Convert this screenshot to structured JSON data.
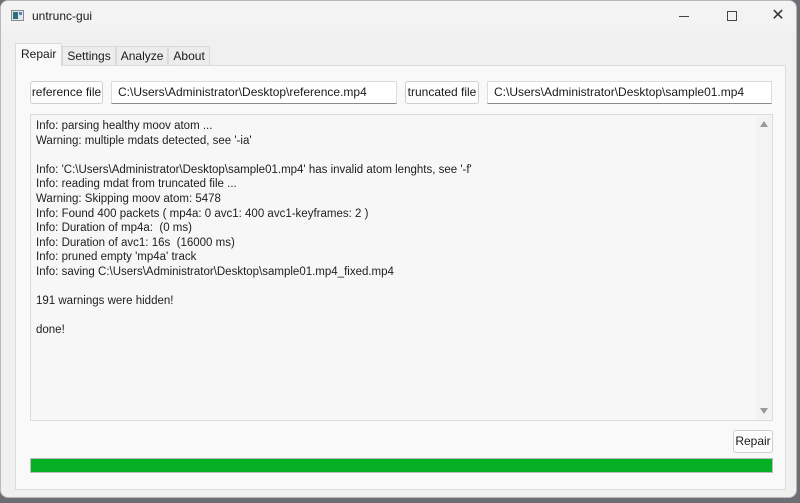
{
  "window": {
    "title": "untrunc-gui",
    "controls": {
      "minimize": "minimize",
      "maximize": "maximize",
      "close": "close"
    }
  },
  "tabs": [
    {
      "label": "Repair",
      "active": true
    },
    {
      "label": "Settings",
      "active": false
    },
    {
      "label": "Analyze",
      "active": false
    },
    {
      "label": "About",
      "active": false
    }
  ],
  "repair": {
    "reference_button": "reference file",
    "reference_path": "C:\\Users\\Administrator\\Desktop\\reference.mp4",
    "truncated_button": "truncated file",
    "truncated_path": "C:\\Users\\Administrator\\Desktop\\sample01.mp4",
    "log_lines": [
      "Info: parsing healthy moov atom ...",
      "Warning: multiple mdats detected, see '-ia'",
      "",
      "Info: 'C:\\Users\\Administrator\\Desktop\\sample01.mp4' has invalid atom lenghts, see '-f'",
      "Info: reading mdat from truncated file ...",
      "Warning: Skipping moov atom: 5478",
      "Info: Found 400 packets ( mp4a: 0 avc1: 400 avc1-keyframes: 2 )",
      "Info: Duration of mp4a:  (0 ms)",
      "Info: Duration of avc1: 16s  (16000 ms)",
      "Info: pruned empty 'mp4a' track",
      "Info: saving C:\\Users\\Administrator\\Desktop\\sample01.mp4_fixed.mp4",
      "",
      "191 warnings were hidden!",
      "",
      "done!"
    ],
    "repair_button": "Repair",
    "progress_percent": 100,
    "progress_color": "#06b025"
  }
}
